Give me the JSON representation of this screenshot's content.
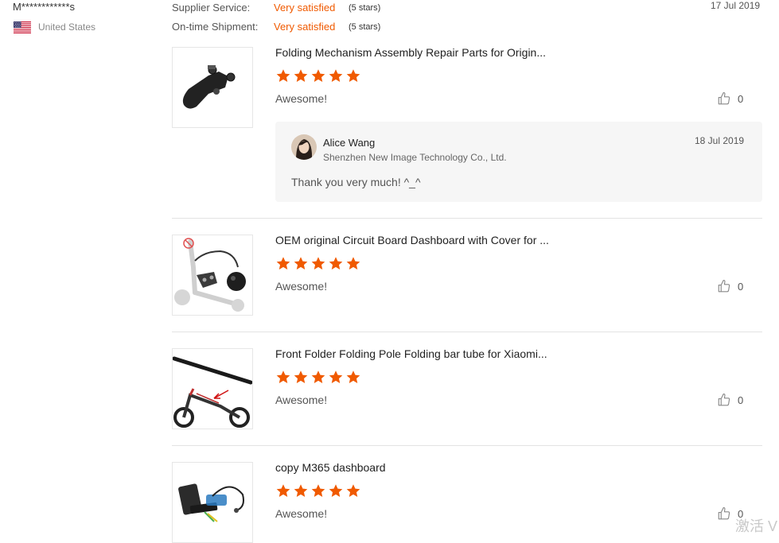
{
  "reviewer": {
    "name": "M************s",
    "country": "United States",
    "flag_icon": "us-flag-icon"
  },
  "ratings": {
    "supplier_label": "Supplier Service:",
    "supplier_value": "Very satisfied",
    "supplier_stars": "(5 stars)",
    "shipment_label": "On-time Shipment:",
    "shipment_value": "Very satisfied",
    "shipment_stars": "(5 stars)"
  },
  "review_date": "17 Jul 2019",
  "items": [
    {
      "title": "Folding Mechanism Assembly Repair Parts for Origin...",
      "stars": 5,
      "review": "Awesome!",
      "likes": "0",
      "image_icon": "folding-mechanism-photo"
    },
    {
      "title": "OEM original Circuit Board Dashboard with Cover for ...",
      "stars": 5,
      "review": "Awesome!",
      "likes": "0",
      "image_icon": "scooter-dashboard-photo"
    },
    {
      "title": "Front Folder Folding Pole Folding bar tube for Xiaomi...",
      "stars": 5,
      "review": "Awesome!",
      "likes": "0",
      "image_icon": "folding-pole-photo"
    },
    {
      "title": "copy M365 dashboard",
      "stars": 5,
      "review": "Awesome!",
      "likes": "0",
      "image_icon": "m365-dashboard-photo"
    }
  ],
  "seller_reply": {
    "name": "Alice Wang",
    "company": "Shenzhen New Image Technology Co., Ltd.",
    "date": "18 Jul 2019",
    "text": "Thank you very much! ^_^"
  },
  "watermark": "激活 V",
  "colors": {
    "accent": "#f05a00",
    "star": "#f05a00",
    "divider": "#e3e3e3",
    "reply_bg": "#f6f6f6"
  }
}
